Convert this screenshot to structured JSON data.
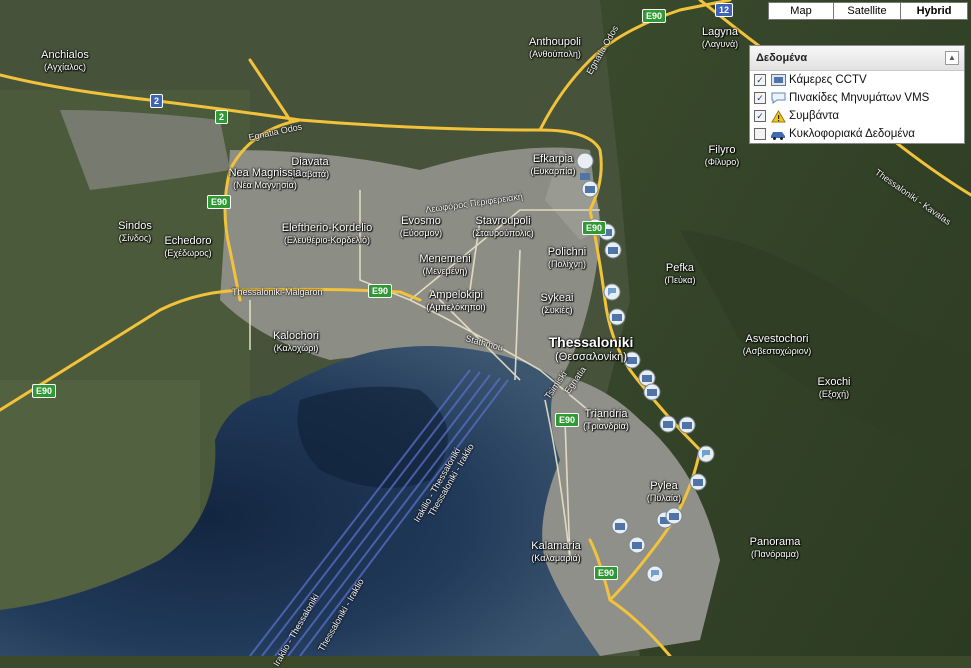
{
  "map_type_buttons": [
    {
      "label": "Map",
      "selected": false
    },
    {
      "label": "Satellite",
      "selected": false
    },
    {
      "label": "Hybrid",
      "selected": true
    }
  ],
  "layers_panel": {
    "title": "Δεδομένα",
    "items": [
      {
        "label": "Κάμερες CCTV",
        "checked": true,
        "icon": "camera-icon"
      },
      {
        "label": "Πινακίδες Μηνυμάτων VMS",
        "checked": true,
        "icon": "message-sign-icon"
      },
      {
        "label": "Συμβάντα",
        "checked": true,
        "icon": "warning-icon"
      },
      {
        "label": "Κυκλοφοριακά Δεδομένα",
        "checked": false,
        "icon": "car-icon"
      }
    ]
  },
  "places": [
    {
      "id": "anchialos",
      "name": "Anchialos",
      "greek": "(Αγχίαλος)"
    },
    {
      "id": "anthoupoli",
      "name": "Anthoupoli",
      "greek": "(Ανθούπολη)"
    },
    {
      "id": "lagyna",
      "name": "Lagyna",
      "greek": "(Λαγυνά)"
    },
    {
      "id": "diavata",
      "name": "Diavata",
      "greek": "(Διαβατά)"
    },
    {
      "id": "nea-magnissia",
      "name": "Nea Magnissia",
      "greek": "(Νέα Μαγνησία)"
    },
    {
      "id": "efkarpia",
      "name": "Efkarpia",
      "greek": "(Ευκαρπία)"
    },
    {
      "id": "filyro",
      "name": "Filyro",
      "greek": "(Φίλυρο)"
    },
    {
      "id": "sindos",
      "name": "Sindos",
      "greek": "(Σίνδος)"
    },
    {
      "id": "echedoro",
      "name": "Echedoro",
      "greek": "(Εχέδωρος)"
    },
    {
      "id": "eleftherio",
      "name": "Eleftherio-Kordelio",
      "greek": "(Ελευθέριο-Κορδελιό)"
    },
    {
      "id": "evosmo",
      "name": "Evosmo",
      "greek": "(Εύοσμον)"
    },
    {
      "id": "stavroupoli",
      "name": "Stavroupoli",
      "greek": "(Σταυρούπολις)"
    },
    {
      "id": "polichni",
      "name": "Polichni",
      "greek": "(Πολίχνη)"
    },
    {
      "id": "menemeni",
      "name": "Menemeni",
      "greek": "(Μενεμένη)"
    },
    {
      "id": "pefka",
      "name": "Pefka",
      "greek": "(Πεύκα)"
    },
    {
      "id": "ampelokipi",
      "name": "Ampelokipi",
      "greek": "(Αμπελόκηποι)"
    },
    {
      "id": "sykeai",
      "name": "Sykeai",
      "greek": "(Συκιές)"
    },
    {
      "id": "kalochori",
      "name": "Kalochori",
      "greek": "(Καλοχώρι)"
    },
    {
      "id": "thessaloniki",
      "name": "Thessaloniki",
      "greek": "(Θεσσαλονίκη)"
    },
    {
      "id": "asvestochori",
      "name": "Asvestochori",
      "greek": "(Ασβεστοχώριον)"
    },
    {
      "id": "exochi",
      "name": "Exochi",
      "greek": "(Εξοχή)"
    },
    {
      "id": "triandria",
      "name": "Triandria",
      "greek": "(Τριανδρία)"
    },
    {
      "id": "pylea",
      "name": "Pylea",
      "greek": "(Πυλαία)"
    },
    {
      "id": "panorama",
      "name": "Panorama",
      "greek": "(Πανόραμα)"
    },
    {
      "id": "kalamaria",
      "name": "Kalamaria",
      "greek": "(Καλαμαριά)"
    }
  ],
  "road_labels": [
    {
      "id": "egnatia-odos-west",
      "text": "Egnatia Odos"
    },
    {
      "id": "egnatia-odos-north",
      "text": "Egnatia Odos"
    },
    {
      "id": "thessaloniki-malgaron",
      "text": "Thessaloniki-Malgaron"
    },
    {
      "id": "leoforos",
      "text": "Λεωφόρος Περιφερειακή"
    },
    {
      "id": "stathmou",
      "text": "Stathmou"
    },
    {
      "id": "egnatia-city",
      "text": "Egnatia"
    },
    {
      "id": "tsimiski",
      "text": "Tsimiski"
    },
    {
      "id": "thessaloniki-kavalas",
      "text": "Thessaloniki - Kavalas"
    },
    {
      "id": "iraklio-thessaloniki",
      "text": "Irakilio - Thessaloniki"
    },
    {
      "id": "thessaloniki-iraklio",
      "text": "Thessaloniki - Iraklio"
    },
    {
      "id": "iraklio-thess-2",
      "text": "Iraklio - Thessaloniki"
    },
    {
      "id": "thess-iraklio-2",
      "text": "Thessaloniki - Iraklio"
    }
  ],
  "shields": [
    {
      "id": "e90-top",
      "text": "E90",
      "color": "green"
    },
    {
      "id": "route-12",
      "text": "12",
      "color": "blue"
    },
    {
      "id": "route-2-a",
      "text": "2",
      "color": "blue"
    },
    {
      "id": "route-2-b",
      "text": "2",
      "color": "green"
    },
    {
      "id": "e90-west",
      "text": "E90",
      "color": "green"
    },
    {
      "id": "e90-mid",
      "text": "E90",
      "color": "green"
    },
    {
      "id": "e90-farwest",
      "text": "E90",
      "color": "green"
    },
    {
      "id": "e90-east",
      "text": "E90",
      "color": "green"
    },
    {
      "id": "e90-triandria",
      "text": "E90",
      "color": "green"
    },
    {
      "id": "e90-kalamaria",
      "text": "E90",
      "color": "green"
    }
  ],
  "colors": {
    "land_dark": "#34422a",
    "land_urban": "#8d8e86",
    "sea": "#1f3452",
    "highway": "#f2c23b",
    "road": "#e8e3c8",
    "camera_marker": "#4f74a8",
    "vms_marker": "#e6eef6"
  }
}
